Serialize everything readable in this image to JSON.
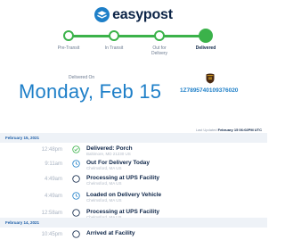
{
  "brand": {
    "name": "easypost",
    "logo_icon": "easypost-logo-icon"
  },
  "progress": {
    "steps": [
      "Pre-Transit",
      "In Transit",
      "Out for Delivery",
      "Delivered"
    ],
    "current": "Delivered",
    "color": "#3bb24a"
  },
  "delivery": {
    "label": "Delivered On",
    "date": "Monday, Feb 15",
    "carrier_icon": "ups-logo-icon",
    "tracking_number": "1Z7895740109376020"
  },
  "last_updated": {
    "label": "Last Updated",
    "value": "February 15 06:02PM UTC"
  },
  "days": [
    {
      "date": "February 15, 2021",
      "events": [
        {
          "time": "12:48pm",
          "icon": "check-circle-icon",
          "title": "Delivered: Porch",
          "location": "Baltimore, MD 21230 US"
        },
        {
          "time": "9:11am",
          "icon": "clock-icon",
          "title": "Out For Delivery Today",
          "location": "Chelmsford, MA US"
        },
        {
          "time": "4:49am",
          "icon": "circle-icon",
          "title": "Processing at UPS Facility",
          "location": "Chelmsford, MA US"
        },
        {
          "time": "4:49am",
          "icon": "clock-icon",
          "title": "Loaded on Delivery Vehicle",
          "location": "Chelmsford, MA US"
        },
        {
          "time": "12:58am",
          "icon": "circle-icon",
          "title": "Processing at UPS Facility",
          "location": "Chelmsford, MA US"
        }
      ]
    },
    {
      "date": "February 14, 2021",
      "events": [
        {
          "time": "10:45pm",
          "icon": "circle-icon",
          "title": "Arrived at Facility",
          "location": ""
        }
      ]
    }
  ],
  "colors": {
    "brand_navy": "#0c2447",
    "accent_blue": "#1e7fc8",
    "success_green": "#3bb24a"
  }
}
